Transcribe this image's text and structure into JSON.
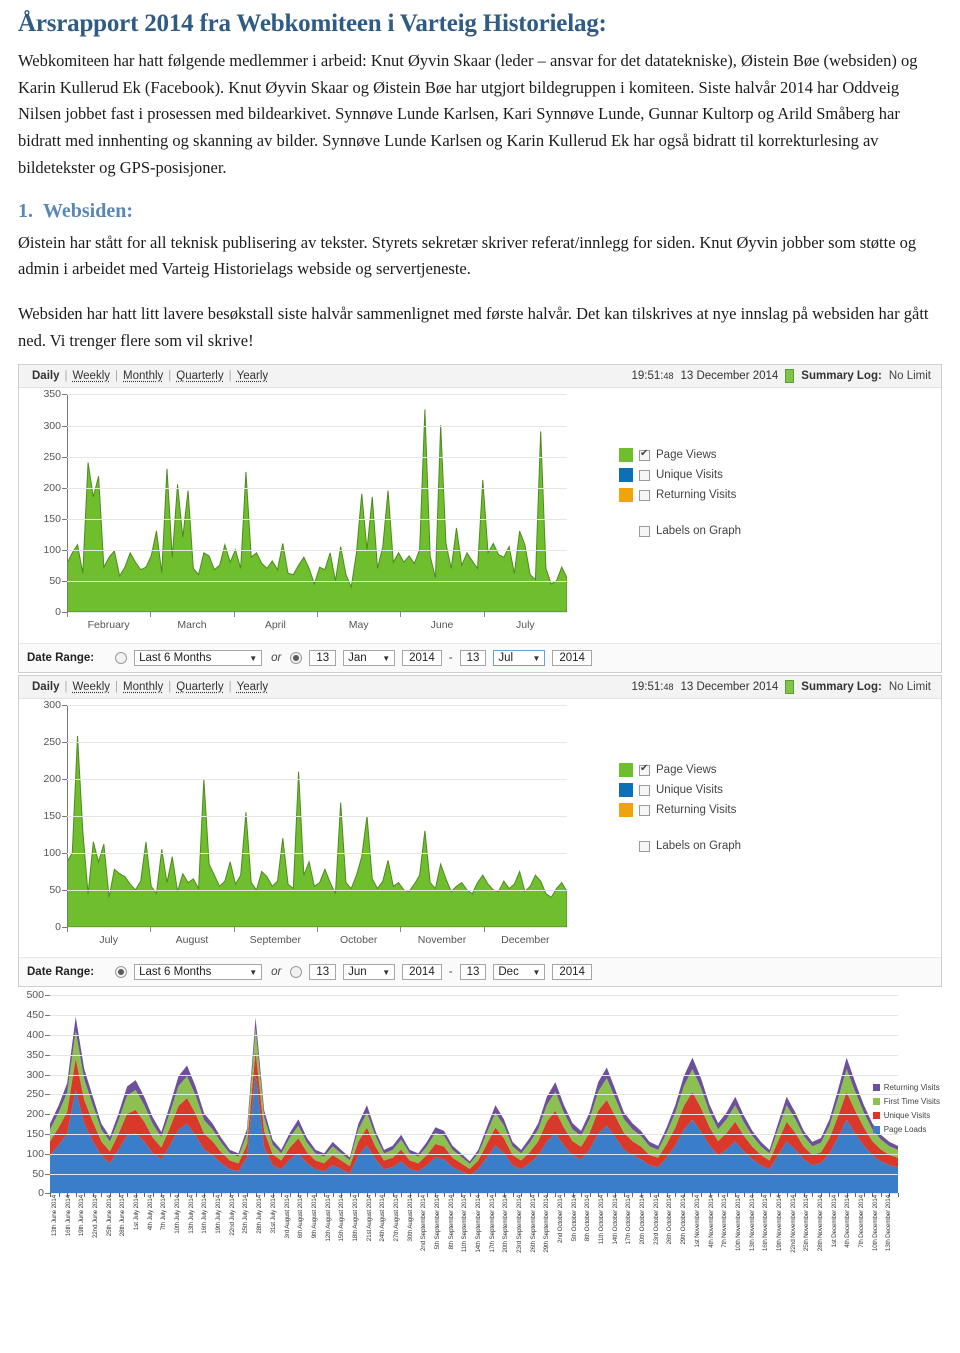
{
  "document": {
    "title": "Årsrapport 2014 fra Webkomiteen i Varteig Historielag:",
    "intro_paragraph": "Webkomiteen har hatt følgende medlemmer i arbeid: Knut Øyvin Skaar (leder – ansvar for det datatekniske), Øistein Bøe (websiden) og Karin Kullerud Ek (Facebook). Knut Øyvin Skaar og Øistein Bøe har utgjort bildegruppen i komiteen. Siste halvår 2014 har Oddveig Nilsen jobbet fast i prosessen med bildearkivet. Synnøve Lunde Karlsen, Kari Synnøve Lunde, Gunnar Kultorp og Arild Småberg har bidratt med innhenting og skanning av bilder. Synnøve Lunde Karlsen og Karin Kullerud Ek har også bidratt til korrekturlesing av bildetekster og GPS-posisjoner.",
    "section_number": "1.",
    "section_title": "Websiden:",
    "section_paragraph": "Øistein har stått for all teknisk publisering av tekster. Styrets sekretær skriver referat/innlegg for siden. Knut Øyvin jobber som støtte og admin i arbeidet med Varteig Historielags webside og servertjeneste.",
    "closing_paragraph": "Websiden har hatt litt lavere besøkstall siste halvår sammenlignet med første halvår. Det kan tilskrives at nye innslag på websiden har gått ned. Vi trenger flere som vil skrive!",
    "title_color": "#2f5b84",
    "section_color": "#5a87b5"
  },
  "stats_panel_1": {
    "tabs": [
      {
        "label": "Daily",
        "active": true
      },
      {
        "label": "Weekly",
        "active": false
      },
      {
        "label": "Monthly",
        "active": false
      },
      {
        "label": "Quarterly",
        "active": false
      },
      {
        "label": "Yearly",
        "active": false
      }
    ],
    "separator": "|",
    "timestamp_time": "19:51:",
    "timestamp_secs": "48",
    "timestamp_date": "13 December 2014",
    "summary_label": "Summary Log:",
    "summary_value": "No Limit",
    "legend": [
      {
        "label": "Page Views",
        "color": "#6fbe2e",
        "checked": true
      },
      {
        "label": "Unique Visits",
        "color": "#0d6fb8",
        "checked": false
      },
      {
        "label": "Returning Visits",
        "color": "#f0a30a",
        "checked": false
      }
    ],
    "legend_extra": {
      "label": "Labels on Graph",
      "checked": false
    },
    "date_range": {
      "label": "Date Range:",
      "preset_selected": false,
      "preset_value": "Last 6 Months",
      "or_text": "or",
      "custom_selected": true,
      "from_day": "13",
      "from_month": "Jan",
      "from_year": "2014",
      "dash": "-",
      "to_day": "13",
      "to_month": "Jul",
      "to_year": "2014"
    }
  },
  "stats_panel_2": {
    "tabs": [
      {
        "label": "Daily",
        "active": true
      },
      {
        "label": "Weekly",
        "active": false
      },
      {
        "label": "Monthly",
        "active": false
      },
      {
        "label": "Quarterly",
        "active": false
      },
      {
        "label": "Yearly",
        "active": false
      }
    ],
    "separator": "|",
    "timestamp_time": "19:51:",
    "timestamp_secs": "48",
    "timestamp_date": "13 December 2014",
    "summary_label": "Summary Log:",
    "summary_value": "No Limit",
    "legend": [
      {
        "label": "Page Views",
        "color": "#6fbe2e",
        "checked": true
      },
      {
        "label": "Unique Visits",
        "color": "#0d6fb8",
        "checked": false
      },
      {
        "label": "Returning Visits",
        "color": "#f0a30a",
        "checked": false
      }
    ],
    "legend_extra": {
      "label": "Labels on Graph",
      "checked": false
    },
    "date_range": {
      "label": "Date Range:",
      "preset_selected": true,
      "preset_value": "Last 6 Months",
      "or_text": "or",
      "custom_selected": false,
      "from_day": "13",
      "from_month": "Jun",
      "from_year": "2014",
      "dash": "-",
      "to_day": "13",
      "to_month": "Dec",
      "to_year": "2014"
    }
  },
  "chart_data": [
    {
      "type": "area",
      "title": "",
      "name": "page-views-jan-jul-2014",
      "xlabel": "",
      "ylabel": "",
      "ylim": [
        0,
        350
      ],
      "yticks": [
        0,
        50,
        100,
        150,
        200,
        250,
        300,
        350
      ],
      "grid": true,
      "legend_position": "right",
      "xtick_labels": [
        "February",
        "March",
        "April",
        "May",
        "June",
        "July"
      ],
      "series": [
        {
          "name": "Page Views",
          "color": "#6fbe2e",
          "values": [
            78,
            95,
            108,
            62,
            240,
            185,
            218,
            72,
            88,
            98,
            58,
            72,
            95,
            80,
            68,
            72,
            90,
            130,
            63,
            230,
            88,
            205,
            120,
            195,
            70,
            60,
            95,
            90,
            68,
            75,
            108,
            80,
            100,
            70,
            225,
            88,
            95,
            78,
            70,
            82,
            68,
            110,
            62,
            60,
            75,
            88,
            70,
            45,
            72,
            68,
            95,
            50,
            105,
            60,
            40,
            95,
            190,
            100,
            185,
            70,
            105,
            195,
            80,
            95,
            80,
            90,
            78,
            100,
            325,
            90,
            55,
            300,
            110,
            70,
            135,
            75,
            95,
            82,
            70,
            212,
            95,
            110,
            92,
            88,
            105,
            62,
            130,
            108,
            60,
            52,
            290,
            70,
            45,
            50,
            72,
            55
          ]
        },
        {
          "name": "Unique Visits",
          "color": "#0d6fb8",
          "values": []
        },
        {
          "name": "Returning Visits",
          "color": "#f0a30a",
          "values": []
        }
      ]
    },
    {
      "type": "area",
      "title": "",
      "name": "page-views-jun-dec-2014",
      "xlabel": "",
      "ylabel": "",
      "ylim": [
        0,
        300
      ],
      "yticks": [
        0,
        50,
        100,
        150,
        200,
        250,
        300
      ],
      "grid": true,
      "legend_position": "right",
      "xtick_labels": [
        "July",
        "August",
        "September",
        "October",
        "November",
        "December"
      ],
      "series": [
        {
          "name": "Page Views",
          "color": "#6fbe2e",
          "values": [
            88,
            100,
            258,
            130,
            45,
            115,
            88,
            112,
            40,
            78,
            72,
            68,
            58,
            50,
            62,
            115,
            55,
            45,
            105,
            60,
            95,
            48,
            72,
            60,
            65,
            52,
            200,
            85,
            70,
            55,
            62,
            88,
            58,
            70,
            155,
            60,
            50,
            75,
            68,
            55,
            62,
            120,
            58,
            52,
            210,
            70,
            88,
            55,
            60,
            78,
            60,
            45,
            168,
            60,
            52,
            70,
            95,
            150,
            65,
            52,
            62,
            90,
            55,
            60,
            50,
            48,
            58,
            70,
            130,
            60,
            52,
            85,
            65,
            48,
            55,
            60,
            50,
            45,
            60,
            70,
            58,
            50,
            48,
            62,
            52,
            58,
            75,
            48,
            55,
            70,
            62,
            45,
            40,
            52,
            60,
            48
          ]
        },
        {
          "name": "Unique Visits",
          "color": "#0d6fb8",
          "values": []
        },
        {
          "name": "Returning Visits",
          "color": "#f0a30a",
          "values": []
        }
      ]
    },
    {
      "type": "area",
      "stacked": true,
      "name": "stacked-visits-june-december-2014",
      "title": "",
      "xlabel": "",
      "ylabel": "",
      "ylim": [
        0,
        500
      ],
      "yticks": [
        0,
        50,
        100,
        150,
        200,
        250,
        300,
        350,
        400,
        450,
        500
      ],
      "grid": true,
      "legend_position": "right",
      "legend_entries": [
        {
          "label": "Returning Visits",
          "color": "#6d4f9c"
        },
        {
          "label": "First Time Visits",
          "color": "#8cc152"
        },
        {
          "label": "Unique Visits",
          "color": "#d9392b"
        },
        {
          "label": "Page Loads",
          "color": "#3a7ec9"
        }
      ],
      "xtick_labels": [
        "13th June 2014",
        "16th June 2014",
        "19th June 2014",
        "22nd June 2014",
        "25th June 2014",
        "28th June 2014",
        "1st July 2014",
        "4th July 2014",
        "7th July 2014",
        "10th July 2014",
        "13th July 2014",
        "16th July 2014",
        "19th July 2014",
        "22nd July 2014",
        "25th July 2014",
        "28th July 2014",
        "31st July 2014",
        "3rd August 2014",
        "6th August 2014",
        "9th August 2014",
        "12th August 2014",
        "15th August 2014",
        "18th August 2014",
        "21st August 2014",
        "24th August 2014",
        "27th August 2014",
        "30th August 2014",
        "2nd September 2014",
        "5th September 2014",
        "8th September 2014",
        "11th September 2014",
        "14th September 2014",
        "17th September 2014",
        "20th September 2014",
        "23rd September 2014",
        "26th September 2014",
        "29th September 2014",
        "2nd October 2014",
        "5th October 2014",
        "8th October 2014",
        "11th October 2014",
        "14th October 2014",
        "17th October 2014",
        "20th October 2014",
        "23rd October 2014",
        "26th October 2014",
        "29th October 2014",
        "1st November 2014",
        "4th November 2014",
        "7th November 2014",
        "10th November 2014",
        "13th November 2014",
        "16th November 2014",
        "19th November 2014",
        "22nd November 2014",
        "25th November 2014",
        "28th November 2014",
        "1st December 2014",
        "4th December 2014",
        "7th December 2014",
        "10th December 2014",
        "13th December 2014"
      ],
      "series": [
        {
          "name": "Page Loads",
          "color": "#3a7ec9",
          "values": [
            95,
            120,
            150,
            260,
            175,
            130,
            95,
            75,
            110,
            145,
            150,
            130,
            100,
            85,
            120,
            160,
            175,
            145,
            110,
            95,
            75,
            60,
            55,
            90,
            300,
            115,
            70,
            60,
            85,
            100,
            75,
            60,
            55,
            70,
            60,
            50,
            95,
            120,
            85,
            60,
            65,
            80,
            60,
            55,
            70,
            90,
            85,
            65,
            55,
            45,
            60,
            90,
            120,
            100,
            70,
            60,
            75,
            95,
            130,
            150,
            120,
            95,
            85,
            110,
            150,
            170,
            140,
            110,
            95,
            85,
            70,
            65,
            90,
            120,
            160,
            185,
            155,
            120,
            95,
            110,
            130,
            105,
            85,
            70,
            60,
            95,
            130,
            110,
            85,
            70,
            75,
            100,
            140,
            185,
            150,
            120,
            95,
            80,
            70,
            65
          ]
        },
        {
          "name": "Unique Visits",
          "color": "#d9392b",
          "values": [
            35,
            45,
            55,
            80,
            60,
            50,
            35,
            30,
            40,
            55,
            60,
            50,
            40,
            30,
            45,
            60,
            65,
            55,
            40,
            35,
            28,
            22,
            20,
            32,
            60,
            42,
            28,
            22,
            30,
            38,
            28,
            22,
            20,
            26,
            22,
            18,
            35,
            45,
            32,
            22,
            24,
            30,
            22,
            20,
            26,
            34,
            32,
            24,
            20,
            16,
            22,
            34,
            45,
            38,
            26,
            22,
            28,
            36,
            50,
            58,
            45,
            36,
            32,
            42,
            58,
            65,
            54,
            42,
            36,
            32,
            26,
            24,
            34,
            45,
            60,
            70,
            60,
            46,
            36,
            42,
            50,
            40,
            32,
            26,
            22,
            36,
            50,
            42,
            32,
            26,
            28,
            38,
            54,
            70,
            58,
            46,
            36,
            30,
            26,
            24
          ]
        },
        {
          "name": "First Time Visits",
          "color": "#8cc152",
          "values": [
            30,
            38,
            48,
            70,
            52,
            42,
            30,
            25,
            34,
            46,
            50,
            42,
            34,
            26,
            38,
            50,
            55,
            46,
            34,
            30,
            24,
            18,
            17,
            27,
            55,
            35,
            24,
            18,
            25,
            32,
            24,
            18,
            17,
            22,
            18,
            15,
            30,
            38,
            27,
            18,
            20,
            25,
            18,
            17,
            22,
            28,
            27,
            20,
            17,
            13,
            18,
            28,
            38,
            32,
            22,
            18,
            24,
            30,
            42,
            48,
            38,
            30,
            27,
            35,
            48,
            55,
            45,
            35,
            30,
            27,
            22,
            20,
            28,
            38,
            50,
            58,
            50,
            38,
            30,
            35,
            42,
            34,
            27,
            22,
            18,
            30,
            42,
            35,
            27,
            22,
            24,
            32,
            45,
            58,
            48,
            38,
            30,
            25,
            22,
            20
          ]
        },
        {
          "name": "Returning Visits",
          "color": "#6d4f9c",
          "values": [
            15,
            18,
            24,
            35,
            26,
            21,
            15,
            12,
            17,
            23,
            25,
            21,
            17,
            13,
            19,
            25,
            27,
            23,
            17,
            15,
            12,
            9,
            8,
            13,
            28,
            17,
            12,
            9,
            12,
            16,
            12,
            9,
            8,
            11,
            9,
            7,
            15,
            19,
            13,
            9,
            10,
            12,
            9,
            8,
            11,
            14,
            13,
            10,
            8,
            6,
            9,
            14,
            19,
            16,
            11,
            9,
            12,
            15,
            21,
            24,
            19,
            15,
            13,
            17,
            24,
            27,
            22,
            17,
            15,
            13,
            11,
            10,
            14,
            19,
            25,
            29,
            25,
            19,
            15,
            17,
            21,
            17,
            13,
            11,
            9,
            15,
            21,
            17,
            13,
            11,
            12,
            16,
            22,
            29,
            24,
            19,
            15,
            12,
            11,
            10
          ]
        }
      ]
    }
  ]
}
